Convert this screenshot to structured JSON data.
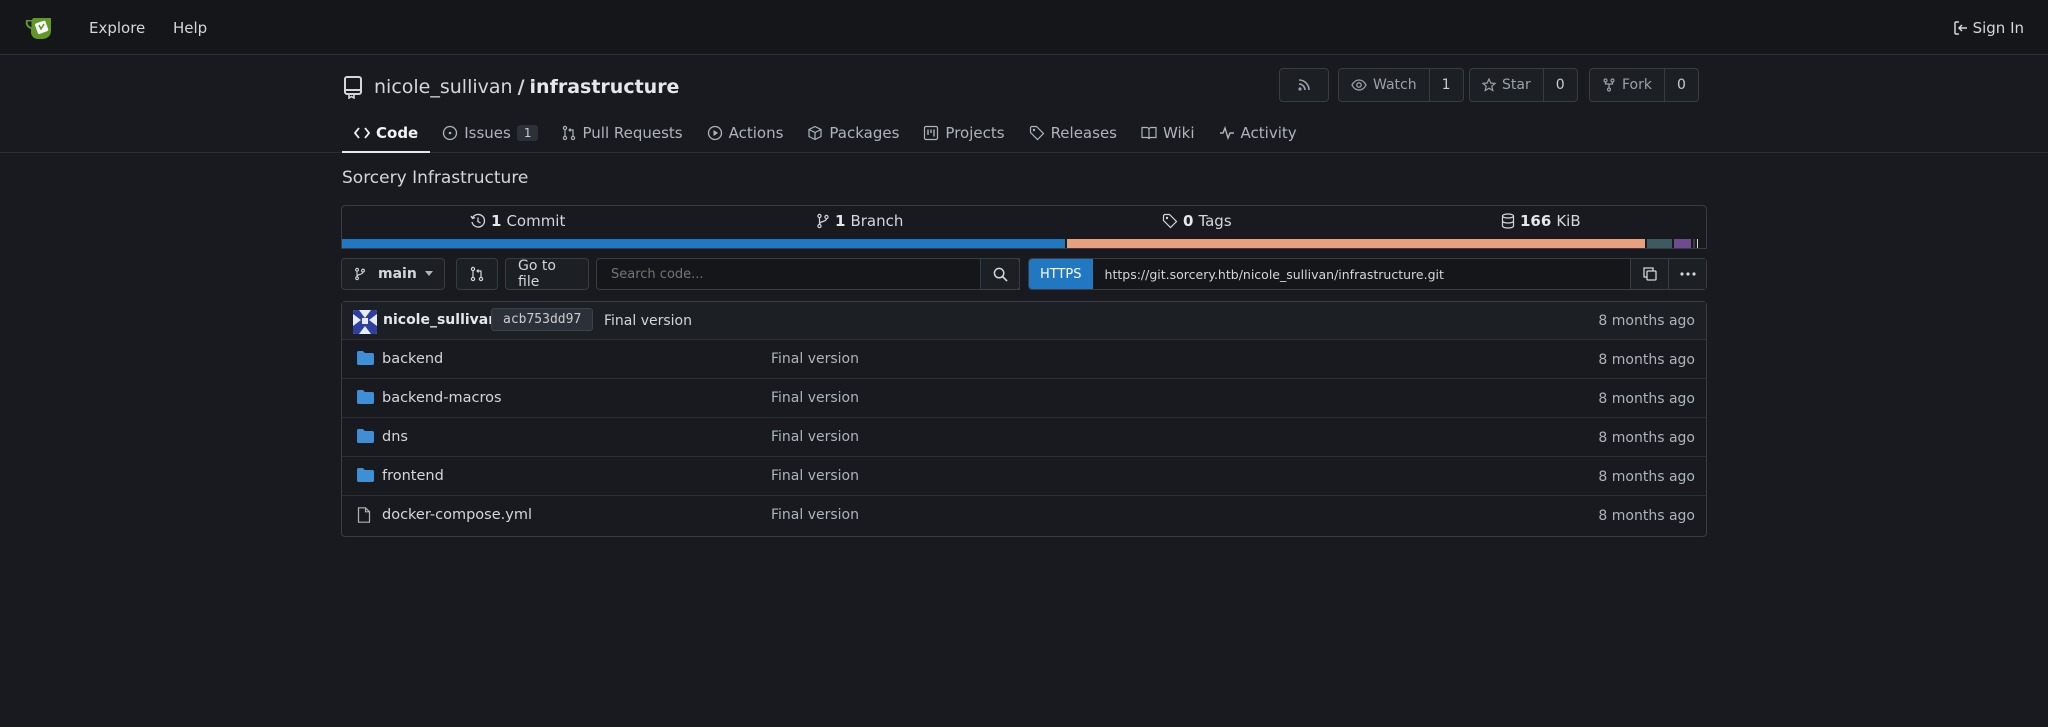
{
  "nav": {
    "explore": "Explore",
    "help": "Help",
    "signin": "Sign In"
  },
  "repo": {
    "owner": "nicole_sullivan",
    "separator": "/",
    "name": "infrastructure",
    "watch_label": "Watch",
    "watch_count": "1",
    "star_label": "Star",
    "star_count": "0",
    "fork_label": "Fork",
    "fork_count": "0"
  },
  "tabs": [
    {
      "label": "Code",
      "icon": "code-icon"
    },
    {
      "label": "Issues",
      "icon": "issue-icon",
      "badge": "1"
    },
    {
      "label": "Pull Requests",
      "icon": "pull-request-icon"
    },
    {
      "label": "Actions",
      "icon": "play-icon"
    },
    {
      "label": "Packages",
      "icon": "package-icon"
    },
    {
      "label": "Projects",
      "icon": "project-icon"
    },
    {
      "label": "Releases",
      "icon": "tag-icon"
    },
    {
      "label": "Wiki",
      "icon": "book-icon"
    },
    {
      "label": "Activity",
      "icon": "pulse-icon"
    }
  ],
  "description": "Sorcery Infrastructure",
  "stats": {
    "commits_num": "1",
    "commits_label": "Commit",
    "branches_num": "1",
    "branches_label": "Branch",
    "tags_num": "0",
    "tags_label": "Tags",
    "size_num": "166",
    "size_label": "KiB"
  },
  "language_bar": [
    {
      "color": "#1f78c1",
      "share": 0.53
    },
    {
      "color": "#e8a17f",
      "share": 0.425
    },
    {
      "color": "#3c5a60",
      "share": 0.02
    },
    {
      "color": "#6e4a8e",
      "share": 0.014
    },
    {
      "color": "#3a3f46",
      "share": 0.003
    },
    {
      "color": "#d8d8c0",
      "share": 0.002
    },
    {
      "color": "#7fbf8f",
      "share": 0.002
    }
  ],
  "toolbar": {
    "branch": "main",
    "go_to_file": "Go to file",
    "search_placeholder": "Search code...",
    "https_label": "HTTPS",
    "clone_url": "https://git.sorcery.htb/nicole_sullivan/infrastructure.git"
  },
  "latest_commit": {
    "author": "nicole_sullivan",
    "sha": "acb753dd97",
    "message": "Final version",
    "time": "8 months ago"
  },
  "files": [
    {
      "name": "backend",
      "type": "folder",
      "message": "Final version",
      "time": "8 months ago"
    },
    {
      "name": "backend-macros",
      "type": "folder",
      "message": "Final version",
      "time": "8 months ago"
    },
    {
      "name": "dns",
      "type": "folder",
      "message": "Final version",
      "time": "8 months ago"
    },
    {
      "name": "frontend",
      "type": "folder",
      "message": "Final version",
      "time": "8 months ago"
    },
    {
      "name": "docker-compose.yml",
      "type": "file",
      "message": "Final version",
      "time": "8 months ago"
    }
  ],
  "colors": {
    "accent": "#1f78c1",
    "folder": "#3f8fd6",
    "logo": "#609926"
  }
}
